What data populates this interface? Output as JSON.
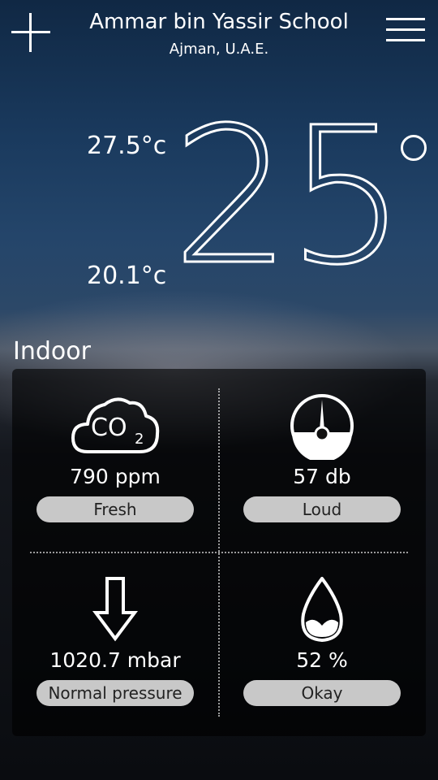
{
  "header": {
    "title": "Ammar bin Yassir School",
    "subtitle": "Ajman, U.A.E."
  },
  "weather": {
    "high": "27.5°c",
    "low": "20.1°c",
    "current": "25"
  },
  "indoor": {
    "label": "Indoor",
    "co2": {
      "icon_text": "CO",
      "icon_sub": "2",
      "value": "790 ppm",
      "status": "Fresh"
    },
    "noise": {
      "value": "57 db",
      "status": "Loud"
    },
    "pressure": {
      "value": "1020.7 mbar",
      "status": "Normal pressure"
    },
    "humidity": {
      "value": "52 %",
      "status": "Okay"
    }
  },
  "icons": {
    "add": "plus-icon",
    "menu": "hamburger-menu-icon",
    "co2": "co2-cloud-icon",
    "noise": "gauge-icon",
    "pressure": "arrow-down-icon",
    "humidity": "water-drop-icon"
  }
}
